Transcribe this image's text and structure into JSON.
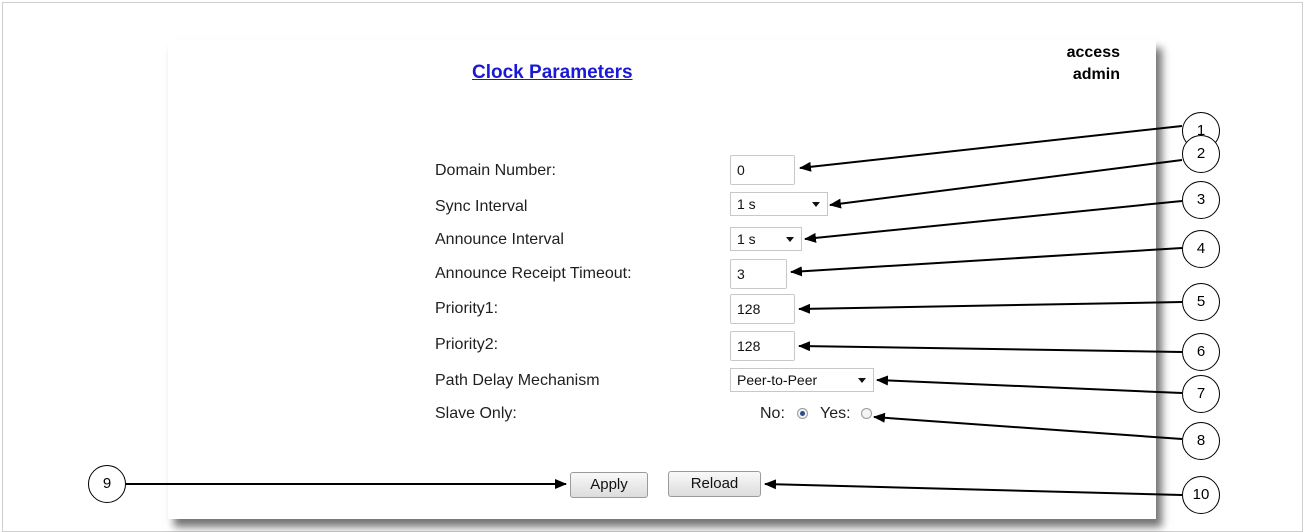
{
  "page": {
    "title": "Clock Parameters",
    "access_heading": "access",
    "access_value": "admin"
  },
  "form": {
    "domain_number": {
      "label": "Domain Number:",
      "value": "0"
    },
    "sync_interval": {
      "label": "Sync Interval",
      "value": "1 s"
    },
    "announce_interval": {
      "label": "Announce Interval",
      "value": "1 s"
    },
    "announce_receipt_timeout": {
      "label": "Announce Receipt Timeout:",
      "value": "3"
    },
    "priority1": {
      "label": "Priority1:",
      "value": "128"
    },
    "priority2": {
      "label": "Priority2:",
      "value": "128"
    },
    "path_delay_mechanism": {
      "label": "Path Delay Mechanism",
      "value": "Peer-to-Peer"
    },
    "slave_only": {
      "label": "Slave Only:",
      "no_label": "No:",
      "yes_label": "Yes:",
      "selected": "No"
    }
  },
  "buttons": {
    "apply": "Apply",
    "reload": "Reload"
  },
  "callouts": [
    "1",
    "2",
    "3",
    "4",
    "5",
    "6",
    "7",
    "8",
    "9",
    "10"
  ]
}
